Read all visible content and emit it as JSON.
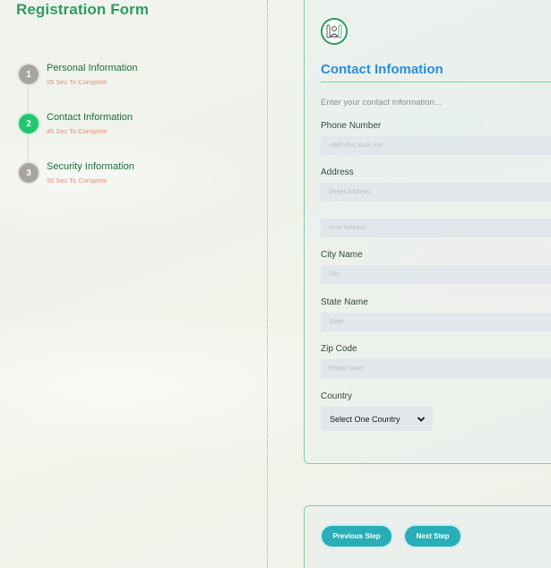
{
  "sidebar": {
    "title": "Registration Form",
    "steps": [
      {
        "number": "1",
        "label": "Personal Information",
        "time": "25 Sec To Complete",
        "active": false
      },
      {
        "number": "2",
        "label": "Contact Information",
        "time": "40 Sec To Complete",
        "active": true
      },
      {
        "number": "3",
        "label": "Security Information",
        "time": "30 Sec To Complete",
        "active": false
      }
    ]
  },
  "form": {
    "section_title": "Contact Infomation",
    "intro": "Enter your contact information...",
    "phone": {
      "label": "Phone Number",
      "placeholder": "+880 Xxx Xxxx Xxx"
    },
    "address": {
      "label": "Address",
      "street_placeholder": "Street Address",
      "area_placeholder": "Area Address"
    },
    "city": {
      "label": "City Name",
      "placeholder": "City"
    },
    "state": {
      "label": "State Name",
      "placeholder": "State"
    },
    "zip": {
      "label": "Zip Code",
      "placeholder": "Postal Code"
    },
    "country": {
      "label": "Country",
      "selected": "Select One Country"
    }
  },
  "actions": {
    "previous_label": "Previous Step",
    "next_label": "Next Step"
  },
  "colors": {
    "accent_green": "#2e9c64",
    "active_step": "#22c66f",
    "title_blue": "#2a8fd6",
    "button_teal": "#28aeb8",
    "time_text": "#ea8b7a"
  }
}
